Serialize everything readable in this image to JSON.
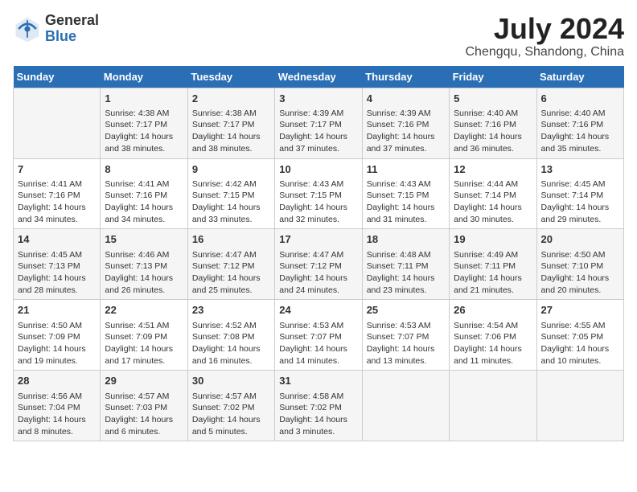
{
  "header": {
    "logo_general": "General",
    "logo_blue": "Blue",
    "month_year": "July 2024",
    "location": "Chengqu, Shandong, China"
  },
  "weekdays": [
    "Sunday",
    "Monday",
    "Tuesday",
    "Wednesday",
    "Thursday",
    "Friday",
    "Saturday"
  ],
  "weeks": [
    [
      {
        "day": "",
        "info": ""
      },
      {
        "day": "1",
        "info": "Sunrise: 4:38 AM\nSunset: 7:17 PM\nDaylight: 14 hours\nand 38 minutes."
      },
      {
        "day": "2",
        "info": "Sunrise: 4:38 AM\nSunset: 7:17 PM\nDaylight: 14 hours\nand 38 minutes."
      },
      {
        "day": "3",
        "info": "Sunrise: 4:39 AM\nSunset: 7:17 PM\nDaylight: 14 hours\nand 37 minutes."
      },
      {
        "day": "4",
        "info": "Sunrise: 4:39 AM\nSunset: 7:16 PM\nDaylight: 14 hours\nand 37 minutes."
      },
      {
        "day": "5",
        "info": "Sunrise: 4:40 AM\nSunset: 7:16 PM\nDaylight: 14 hours\nand 36 minutes."
      },
      {
        "day": "6",
        "info": "Sunrise: 4:40 AM\nSunset: 7:16 PM\nDaylight: 14 hours\nand 35 minutes."
      }
    ],
    [
      {
        "day": "7",
        "info": "Sunrise: 4:41 AM\nSunset: 7:16 PM\nDaylight: 14 hours\nand 34 minutes."
      },
      {
        "day": "8",
        "info": "Sunrise: 4:41 AM\nSunset: 7:16 PM\nDaylight: 14 hours\nand 34 minutes."
      },
      {
        "day": "9",
        "info": "Sunrise: 4:42 AM\nSunset: 7:15 PM\nDaylight: 14 hours\nand 33 minutes."
      },
      {
        "day": "10",
        "info": "Sunrise: 4:43 AM\nSunset: 7:15 PM\nDaylight: 14 hours\nand 32 minutes."
      },
      {
        "day": "11",
        "info": "Sunrise: 4:43 AM\nSunset: 7:15 PM\nDaylight: 14 hours\nand 31 minutes."
      },
      {
        "day": "12",
        "info": "Sunrise: 4:44 AM\nSunset: 7:14 PM\nDaylight: 14 hours\nand 30 minutes."
      },
      {
        "day": "13",
        "info": "Sunrise: 4:45 AM\nSunset: 7:14 PM\nDaylight: 14 hours\nand 29 minutes."
      }
    ],
    [
      {
        "day": "14",
        "info": "Sunrise: 4:45 AM\nSunset: 7:13 PM\nDaylight: 14 hours\nand 28 minutes."
      },
      {
        "day": "15",
        "info": "Sunrise: 4:46 AM\nSunset: 7:13 PM\nDaylight: 14 hours\nand 26 minutes."
      },
      {
        "day": "16",
        "info": "Sunrise: 4:47 AM\nSunset: 7:12 PM\nDaylight: 14 hours\nand 25 minutes."
      },
      {
        "day": "17",
        "info": "Sunrise: 4:47 AM\nSunset: 7:12 PM\nDaylight: 14 hours\nand 24 minutes."
      },
      {
        "day": "18",
        "info": "Sunrise: 4:48 AM\nSunset: 7:11 PM\nDaylight: 14 hours\nand 23 minutes."
      },
      {
        "day": "19",
        "info": "Sunrise: 4:49 AM\nSunset: 7:11 PM\nDaylight: 14 hours\nand 21 minutes."
      },
      {
        "day": "20",
        "info": "Sunrise: 4:50 AM\nSunset: 7:10 PM\nDaylight: 14 hours\nand 20 minutes."
      }
    ],
    [
      {
        "day": "21",
        "info": "Sunrise: 4:50 AM\nSunset: 7:09 PM\nDaylight: 14 hours\nand 19 minutes."
      },
      {
        "day": "22",
        "info": "Sunrise: 4:51 AM\nSunset: 7:09 PM\nDaylight: 14 hours\nand 17 minutes."
      },
      {
        "day": "23",
        "info": "Sunrise: 4:52 AM\nSunset: 7:08 PM\nDaylight: 14 hours\nand 16 minutes."
      },
      {
        "day": "24",
        "info": "Sunrise: 4:53 AM\nSunset: 7:07 PM\nDaylight: 14 hours\nand 14 minutes."
      },
      {
        "day": "25",
        "info": "Sunrise: 4:53 AM\nSunset: 7:07 PM\nDaylight: 14 hours\nand 13 minutes."
      },
      {
        "day": "26",
        "info": "Sunrise: 4:54 AM\nSunset: 7:06 PM\nDaylight: 14 hours\nand 11 minutes."
      },
      {
        "day": "27",
        "info": "Sunrise: 4:55 AM\nSunset: 7:05 PM\nDaylight: 14 hours\nand 10 minutes."
      }
    ],
    [
      {
        "day": "28",
        "info": "Sunrise: 4:56 AM\nSunset: 7:04 PM\nDaylight: 14 hours\nand 8 minutes."
      },
      {
        "day": "29",
        "info": "Sunrise: 4:57 AM\nSunset: 7:03 PM\nDaylight: 14 hours\nand 6 minutes."
      },
      {
        "day": "30",
        "info": "Sunrise: 4:57 AM\nSunset: 7:02 PM\nDaylight: 14 hours\nand 5 minutes."
      },
      {
        "day": "31",
        "info": "Sunrise: 4:58 AM\nSunset: 7:02 PM\nDaylight: 14 hours\nand 3 minutes."
      },
      {
        "day": "",
        "info": ""
      },
      {
        "day": "",
        "info": ""
      },
      {
        "day": "",
        "info": ""
      }
    ]
  ]
}
